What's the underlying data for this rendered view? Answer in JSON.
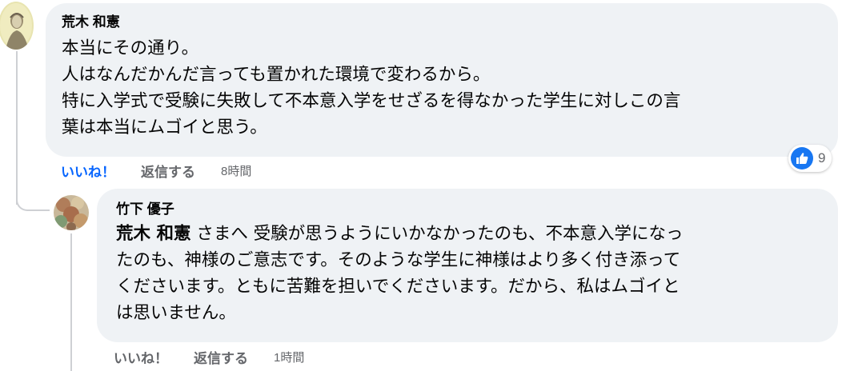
{
  "comments": [
    {
      "author": "荒木 和憲",
      "text": "本当にその通り。\n人はなんだかんだ言っても置かれた環境で変わるから。\n特に入学式で受験に失敗して不本意入学をせざるを得なかった学生に対しこの言\n葉は本当にムゴイと思う。",
      "actions": {
        "like": "いいね！",
        "reply": "返信する",
        "time": "8時間"
      },
      "reaction": {
        "icon": "thumbs-up-icon",
        "count": "9",
        "color": "#1877f2"
      }
    }
  ],
  "replies": [
    {
      "author": "竹下 優子",
      "mention": "荒木 和憲",
      "text": " さまへ 受験が思うようにいかなかったのも、不本意入学になっ\nたのも、神様のご意志です。そのような学生に神様はより多く付き添って\nくださいます。ともに苦難を担いでくださいます。だから、私はムゴイと\nは思いません。",
      "actions": {
        "like": "いいね！",
        "reply": "返信する",
        "time": "1時間"
      }
    }
  ],
  "colors": {
    "bubble": "#eff2f5",
    "secondary_text": "#65676b",
    "liked_blue": "#0866ff",
    "thread_line": "#ced0d4"
  }
}
